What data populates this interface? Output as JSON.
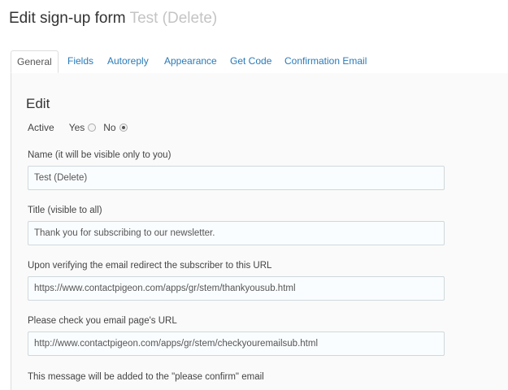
{
  "header": {
    "title": "Edit sign-up form",
    "form_name": "Test (Delete)"
  },
  "tabs": [
    {
      "label": "General"
    },
    {
      "label": "Fields"
    },
    {
      "label": "Autoreply"
    },
    {
      "label": "Appearance"
    },
    {
      "label": "Get Code"
    },
    {
      "label": "Confirmation Email"
    }
  ],
  "section": {
    "title": "Edit"
  },
  "active": {
    "label": "Active",
    "yes_label": "Yes",
    "no_label": "No",
    "selected": "No"
  },
  "fields": {
    "name": {
      "label": "Name (it will be visible only to you)",
      "value": "Test (Delete)"
    },
    "title": {
      "label": "Title (visible to all)",
      "value": "Thank you for subscribing to our newsletter."
    },
    "redirect_url": {
      "label": "Upon verifying the email redirect the subscriber to this URL",
      "value": "https://www.contactpigeon.com/apps/gr/stem/thankyousub.html"
    },
    "check_email_url": {
      "label": "Please check you email page's URL",
      "value": "http://www.contactpigeon.com/apps/gr/stem/checkyouremailsub.html"
    },
    "confirm_message": {
      "label": "This message will be added to the \"please confirm\" email"
    }
  },
  "colors": {
    "tab_link": "#2a7ab8",
    "title_muted": "#c4c4c4",
    "border": "#dddddd"
  }
}
